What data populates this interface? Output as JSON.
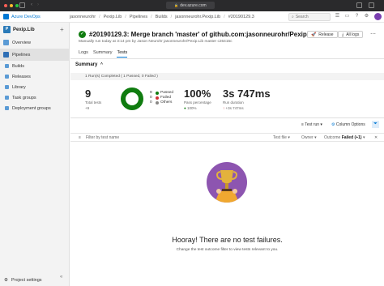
{
  "browser": {
    "address": "dev.azure.com",
    "colors": {
      "close": "#ff5f57",
      "minimize": "#febc2e",
      "zoom": "#28c840"
    }
  },
  "header": {
    "brand": "Azure DevOps",
    "breadcrumbs": [
      "jasonneurohr",
      "Pexip.Lib",
      "Pipelines",
      "Builds",
      "jasonneurohr.Pexip.Lib",
      "#20190129.3"
    ],
    "search_placeholder": "Search",
    "icons": [
      "list-icon",
      "bag-icon",
      "help-icon",
      "user-settings-icon"
    ]
  },
  "sidebar": {
    "project_initial": "P",
    "project_name": "Pexip.Lib",
    "items": [
      {
        "label": "Overview",
        "icon": "overview-icon",
        "active": false
      },
      {
        "label": "Pipelines",
        "icon": "pipelines-icon",
        "active": true
      }
    ],
    "sub_items": [
      {
        "label": "Builds"
      },
      {
        "label": "Releases"
      },
      {
        "label": "Library"
      },
      {
        "label": "Task groups"
      },
      {
        "label": "Deployment groups"
      }
    ],
    "settings_label": "Project settings",
    "collapse_glyph": "«"
  },
  "run": {
    "status_glyph": "✓",
    "title": "#20190129.3: Merge branch 'master' of github.com:jasonneurohr/Pexip.Lib",
    "info": "Manually run today at 3:14 pm by Jason Neurohr    jasonneurohr/Pexip.Lib    master    c26415c",
    "release_label": "Release",
    "all_logs_label": "All logs",
    "more_glyph": "⋯"
  },
  "tabs": [
    "Logs",
    "Summary",
    "Tests"
  ],
  "active_tab": "Tests",
  "summary": {
    "heading": "Summary",
    "chevron": "^",
    "run_completed": "1 Run(s) Completed ( 1 Passed, 0 Failed )",
    "total_tests_value": "9",
    "total_tests_label": "Total tests",
    "total_tests_delta": "+9",
    "legend": [
      {
        "count": "9",
        "label": "Passed",
        "color": "#107c10"
      },
      {
        "count": "0",
        "label": "Failed",
        "color": "#d13438"
      },
      {
        "count": "0",
        "label": "Others",
        "color": "#8a8886"
      }
    ],
    "pass_value": "100%",
    "pass_label": "Pass percentage",
    "pass_delta": "100%",
    "duration_value": "3s 747ms",
    "duration_label": "Run duration",
    "duration_delta": "+3s 747ms"
  },
  "toolbar": {
    "test_run_label": "Test run",
    "column_options_label": "Column Options"
  },
  "filters": {
    "test_name_placeholder": "Filter by test name",
    "test_file": "Test file",
    "owner": "Owner",
    "outcome_label": "Outcome",
    "outcome_value": "Failed (+1)"
  },
  "empty_state": {
    "heading": "Hooray! There are no test failures.",
    "message": "Change the test outcome filter to view tests relevant to you."
  }
}
